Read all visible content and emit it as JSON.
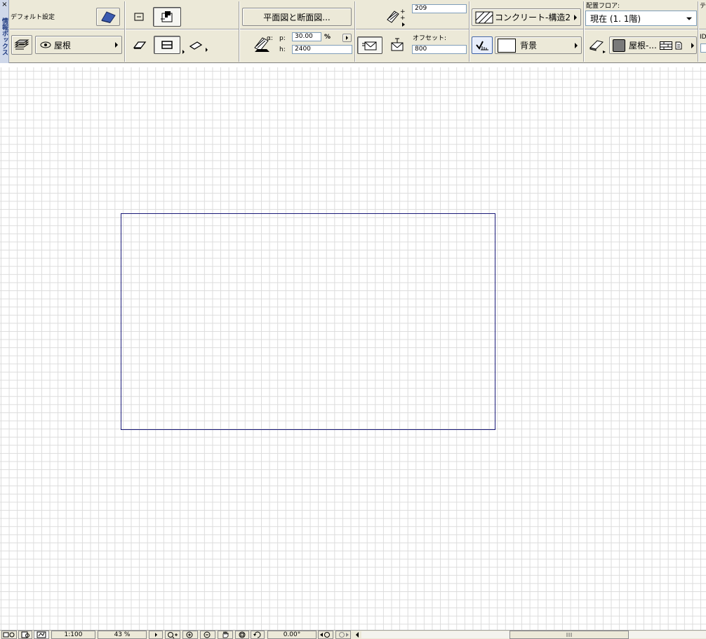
{
  "palette": {
    "toolbar_bg": "#ece9d8",
    "canvas_bg": "#ffffff",
    "grid": "#dcdcdc",
    "roof_outline": "#1a1a78",
    "info_box_strip": "#cfd8ea"
  },
  "info_box": {
    "close_label": "×",
    "vertical_title": "情報ボックス",
    "default_settings_label": "デフォルト設定",
    "roof_tool_icon": "roof-icon",
    "layer_value": "屋根",
    "plan_section_button": "平面図と断面図...",
    "pen_number": "209",
    "material_value": "コンクリート-構造2",
    "floor_label": "配置フロア:",
    "floor_value": "現在 (1. 1階)",
    "id_label": "ID",
    "te_label": "テ",
    "angle_label_alpha": "α:",
    "pitch_label": "p:",
    "pitch_value": "30.00",
    "pitch_unit": "%",
    "height_label": "h:",
    "height_value": "2400",
    "offset_label": "オフセット:",
    "offset_value": "800",
    "fill_bg_value": "背景",
    "roof_type_value": "屋根-..."
  },
  "status_bar": {
    "scale_value": "1:100",
    "zoom_value": "43 %",
    "angle_value": "0.00°"
  }
}
